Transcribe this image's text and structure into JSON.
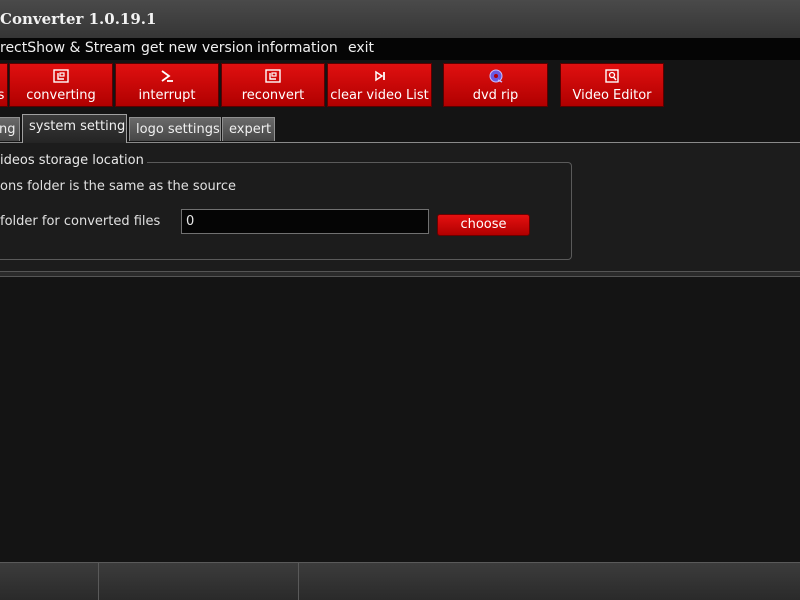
{
  "window": {
    "title": "Converter 1.0.19.1"
  },
  "menu": {
    "items": [
      "rectShow & Stream",
      "get new version",
      "information",
      "exit"
    ]
  },
  "toolbar": {
    "buttons": [
      {
        "label": "s",
        "icon": "partial-icon"
      },
      {
        "label": "converting",
        "icon": "convert-icon"
      },
      {
        "label": "interrupt",
        "icon": "interrupt-icon"
      },
      {
        "label": "reconvert",
        "icon": "reconvert-icon"
      },
      {
        "label": "clear video List",
        "icon": "skip-icon"
      },
      {
        "label": "dvd rip",
        "icon": "disc-icon"
      },
      {
        "label": "Video Editor",
        "icon": "video-editor-icon"
      }
    ]
  },
  "tabs": [
    {
      "label": "ng",
      "active": false
    },
    {
      "label": "system settings",
      "active": true
    },
    {
      "label": "logo settings",
      "active": false
    },
    {
      "label": "expert",
      "active": false
    }
  ],
  "settings": {
    "group_title": "ideos storage location",
    "same_folder_option": "ons folder is the same as the source",
    "folder_label": "folder for converted files",
    "folder_value": "0",
    "choose_label": "choose"
  },
  "colors": {
    "accent_red": "#d10a0a",
    "background": "#141414",
    "menubar": "#050505"
  }
}
